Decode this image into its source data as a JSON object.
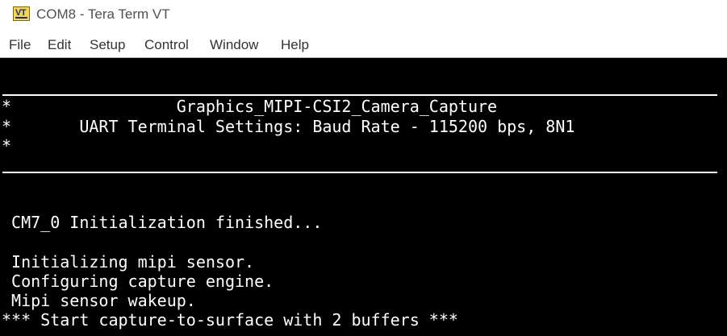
{
  "window": {
    "title": "COM8 - Tera Term VT",
    "icon": "VT"
  },
  "menu": [
    "File",
    "Edit",
    "Setup",
    "Control",
    "Window",
    "Help"
  ],
  "terminal": {
    "lines": [
      "*                 Graphics_MIPI-CSI2_Camera_Capture",
      "*       UART Terminal Settings: Baud Rate - 115200 bps, 8N1",
      "*",
      " CM7_0 Initialization finished...",
      " Initializing mipi sensor.",
      " Configuring capture engine.",
      " Mipi sensor wakeup.",
      "*** Start capture-to-surface with 2 buffers ***"
    ]
  },
  "colors": {
    "terminal_bg": "#000000",
    "terminal_fg": "#ffffff",
    "title_text": "#505050",
    "menu_text": "#333333",
    "icon_bg": "#f7d64a",
    "icon_fg": "#1e2d8a"
  }
}
